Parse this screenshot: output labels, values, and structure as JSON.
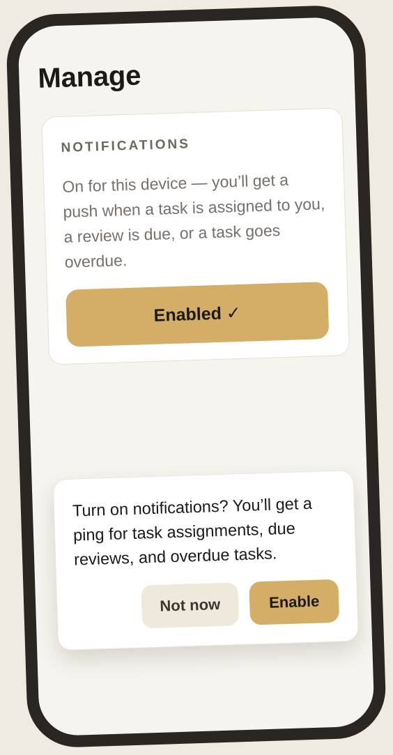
{
  "page": {
    "title": "Manage"
  },
  "notifications_card": {
    "eyebrow": "NOTIFICATIONS",
    "description": "On for this device — you’ll get a push when a task is assigned to you, a review is due, or a task goes overdue.",
    "enabled_button_label": "Enabled ✓"
  },
  "permission_prompt": {
    "message": "Turn on notifications? You’ll get a ping for task assignments, due reviews, and overdue tasks.",
    "dismiss_label": "Not now",
    "confirm_label": "Enable"
  },
  "colors": {
    "accent": "#d4ad66",
    "background": "#efebe2",
    "screen": "#f6f4ef",
    "frame": "#2a2622",
    "secondary_button": "#efe9dc"
  }
}
